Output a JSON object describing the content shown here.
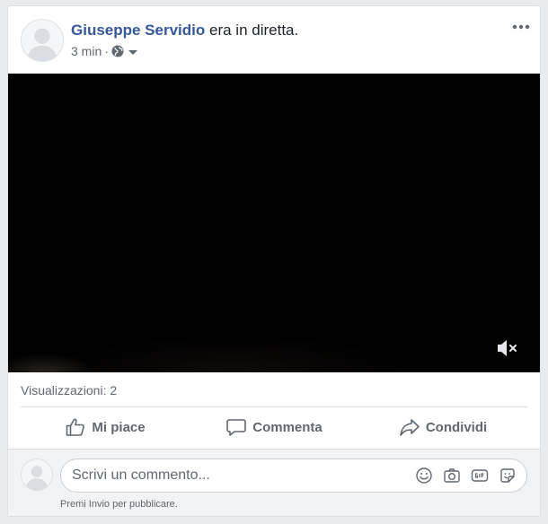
{
  "post": {
    "author": "Giuseppe Servidio",
    "action": "era in diretta.",
    "time": "3 min",
    "separator": "·",
    "privacy_icon": "globe-icon",
    "options_icon": "more-icon"
  },
  "video": {
    "state": "muted",
    "mute_icon": "speaker-muted-icon"
  },
  "stats": {
    "views": "Visualizzazioni: 2"
  },
  "actions": {
    "like": "Mi piace",
    "comment": "Commenta",
    "share": "Condividi"
  },
  "comment_box": {
    "placeholder": "Scrivi un commento...",
    "hint": "Premi Invio per pubblicare.",
    "icons": [
      "emoji-icon",
      "camera-icon",
      "gif-icon",
      "sticker-icon"
    ]
  },
  "colors": {
    "author": "#365899",
    "secondary_text": "#606770",
    "background": "#e9ebee",
    "comment_area": "#f2f3f5"
  }
}
